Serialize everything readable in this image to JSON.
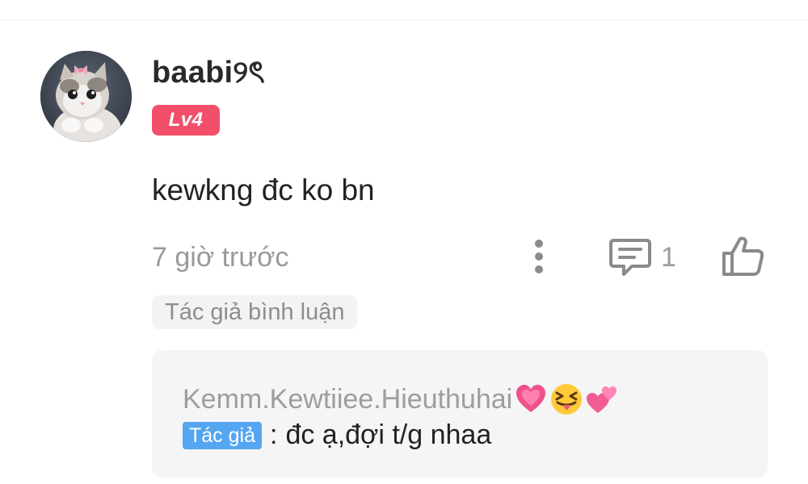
{
  "comment": {
    "username": "baabi୨ৎ",
    "level": "Lv4",
    "text": "kewkng đc ko bn",
    "timestamp": "7 giờ trước",
    "reply_count": "1",
    "author_tag": "Tác giả bình luận",
    "avatar_icon": "cat-avatar",
    "icons": {
      "more": "more-vertical-icon",
      "reply": "comment-icon",
      "like": "thumbs-up-icon"
    }
  },
  "reply": {
    "author_name": "Kemm.Kewtiiee.Hieuthuhai",
    "author_emojis": [
      "growing-heart-emoji",
      "squinting-tongue-emoji",
      "two-hearts-emoji"
    ],
    "badge": "Tác giả",
    "separator": ":",
    "text": "đc ạ,đợi t/g nhaa"
  },
  "colors": {
    "level_badge": "#f2506a",
    "author_badge": "#55a6f0",
    "muted_text": "#9a9a9a"
  }
}
